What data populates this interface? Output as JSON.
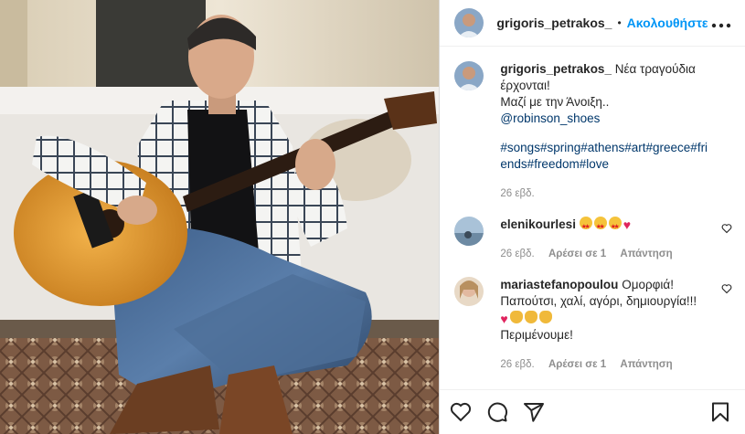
{
  "header": {
    "username": "grigoris_petrakos_",
    "separator": "•",
    "follow_label": "Ακολουθήστε",
    "more_label": "•••"
  },
  "caption": {
    "username": "grigoris_petrakos_",
    "line1": "Νέα τραγούδια έρχονται!",
    "line2": "Μαζί με την Άνοιξη..",
    "mention": "@robinson_shoes",
    "hashtags": "#songs#spring#athens#art#greece#friends#freedom#love",
    "time": "26 εβδ."
  },
  "comments": [
    {
      "username": "elenikourlesi",
      "time": "26 εβδ.",
      "likes": "Αρέσει σε 1",
      "reply": "Απάντηση"
    },
    {
      "username": "mariastefanopoulou",
      "text1": "Ομορφιά!",
      "text2": "Παπούτσι, χαλί, αγόρι, δημιουργία!!!",
      "text3": "Περιμένουμε!",
      "time": "26 εβδ.",
      "likes": "Αρέσει σε 1",
      "reply": "Απάντηση"
    }
  ],
  "icons": {
    "like": "heart-icon",
    "comment": "comment-icon",
    "share": "share-icon",
    "save": "bookmark-icon",
    "more": "more-icon"
  },
  "colors": {
    "link": "#0095f6",
    "hashtag": "#00376b",
    "meta": "#8e8e8e"
  }
}
